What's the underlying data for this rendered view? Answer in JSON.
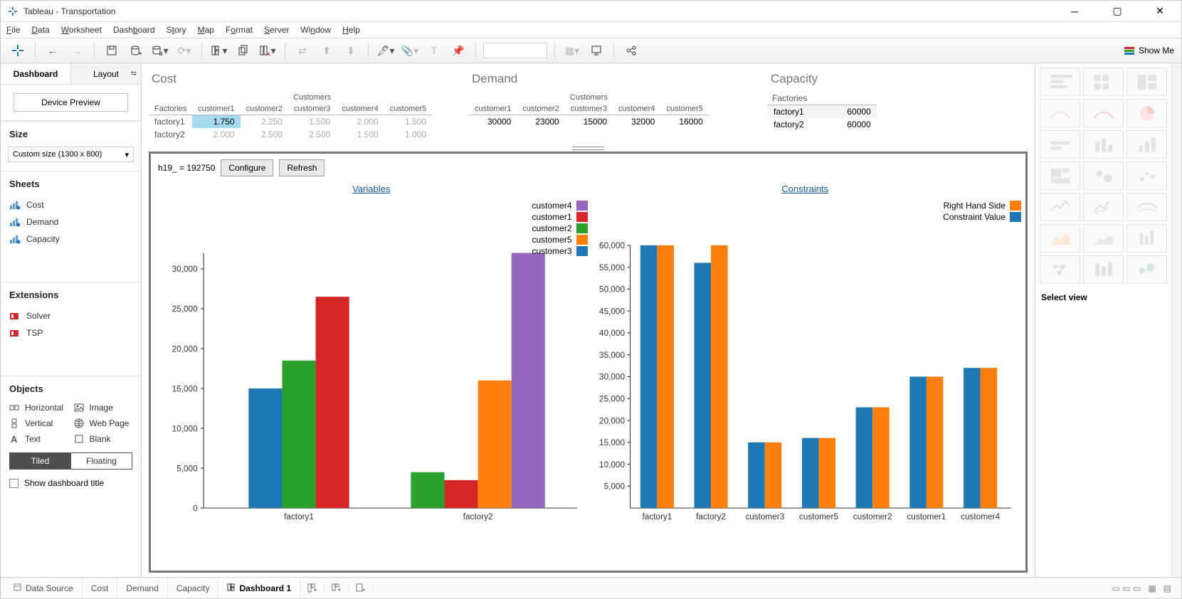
{
  "window": {
    "title": "Tableau - Transportation"
  },
  "menubar": {
    "file": "File",
    "data": "Data",
    "worksheet": "Worksheet",
    "dashboard": "Dashboard",
    "story": "Story",
    "map": "Map",
    "format": "Format",
    "server": "Server",
    "window": "Window",
    "help": "Help"
  },
  "toolbar": {
    "show_me": "Show Me"
  },
  "side_tabs": {
    "dashboard": "Dashboard",
    "layout": "Layout"
  },
  "device_preview": {
    "button": "Device Preview"
  },
  "size": {
    "head": "Size",
    "value": "Custom size (1300 x 800)"
  },
  "sheets": {
    "head": "Sheets",
    "items": [
      {
        "label": "Cost"
      },
      {
        "label": "Demand"
      },
      {
        "label": "Capacity"
      }
    ]
  },
  "extensions": {
    "head": "Extensions",
    "items": [
      {
        "label": "Solver"
      },
      {
        "label": "TSP"
      }
    ]
  },
  "objects": {
    "head": "Objects",
    "horizontal": "Horizontal",
    "image": "Image",
    "vertical": "Vertical",
    "webpage": "Web Page",
    "text": "Text",
    "blank": "Blank"
  },
  "tile_float": {
    "tiled": "Tiled",
    "floating": "Floating"
  },
  "show_title": {
    "label": "Show dashboard title"
  },
  "views": {
    "cost": {
      "title": "Cost",
      "col_head": "Customers",
      "rows_head": "Factories",
      "cols": [
        "customer1",
        "customer2",
        "customer3",
        "customer4",
        "customer5"
      ],
      "data": [
        {
          "row": "factory1",
          "vals": [
            "1.750",
            "2.250",
            "1.500",
            "2.000",
            "1.500"
          ],
          "highlight": 0
        },
        {
          "row": "factory2",
          "vals": [
            "2.000",
            "2.500",
            "2.500",
            "1.500",
            "1.000"
          ]
        }
      ]
    },
    "demand": {
      "title": "Demand",
      "col_head": "Customers",
      "cols": [
        "customer1",
        "customer2",
        "customer3",
        "customer4",
        "customer5"
      ],
      "vals": [
        "30000",
        "23000",
        "15000",
        "32000",
        "16000"
      ]
    },
    "capacity": {
      "title": "Capacity",
      "head": "Factories",
      "rows": [
        {
          "k": "factory1",
          "v": "60000"
        },
        {
          "k": "factory2",
          "v": "60000"
        }
      ]
    }
  },
  "charts_head": {
    "result": "h19_ = 192750",
    "configure": "Configure",
    "refresh": "Refresh"
  },
  "chart_data": [
    {
      "type": "bar",
      "title": "Variables",
      "categories": [
        "factory1",
        "factory2"
      ],
      "y_ticks": [
        0,
        5000,
        10000,
        15000,
        20000,
        25000,
        30000
      ],
      "series": [
        {
          "name": "customer4",
          "color": "#9467bd",
          "values": [
            0,
            32000
          ]
        },
        {
          "name": "customer1",
          "color": "#d62728",
          "values": [
            26500,
            3500
          ]
        },
        {
          "name": "customer2",
          "color": "#2ca02c",
          "values": [
            18500,
            4500
          ]
        },
        {
          "name": "customer5",
          "color": "#ff7f0e",
          "values": [
            0,
            16000
          ]
        },
        {
          "name": "customer3",
          "color": "#1f77b4",
          "values": [
            15000,
            0
          ]
        }
      ],
      "draw_order": [
        "customer3",
        "customer2",
        "customer1",
        "customer5",
        "customer4"
      ]
    },
    {
      "type": "bar",
      "title": "Constraints",
      "categories": [
        "factory1",
        "factory2",
        "customer3",
        "customer5",
        "customer2",
        "customer1",
        "customer4"
      ],
      "y_ticks": [
        5000,
        10000,
        15000,
        20000,
        25000,
        30000,
        35000,
        40000,
        45000,
        50000,
        55000,
        60000
      ],
      "series": [
        {
          "name": "Right Hand Side",
          "color": "#ff7f0e",
          "values": [
            60000,
            60000,
            15000,
            16000,
            23000,
            30000,
            32000
          ]
        },
        {
          "name": "Constraint Value",
          "color": "#1f77b4",
          "values": [
            60000,
            56000,
            15000,
            16000,
            23000,
            30000,
            32000
          ]
        }
      ]
    }
  ],
  "right_pane": {
    "select_view": "Select view"
  },
  "bottom_tabs": {
    "data_source": "Data Source",
    "cost": "Cost",
    "demand": "Demand",
    "capacity": "Capacity",
    "dashboard1": "Dashboard 1"
  }
}
